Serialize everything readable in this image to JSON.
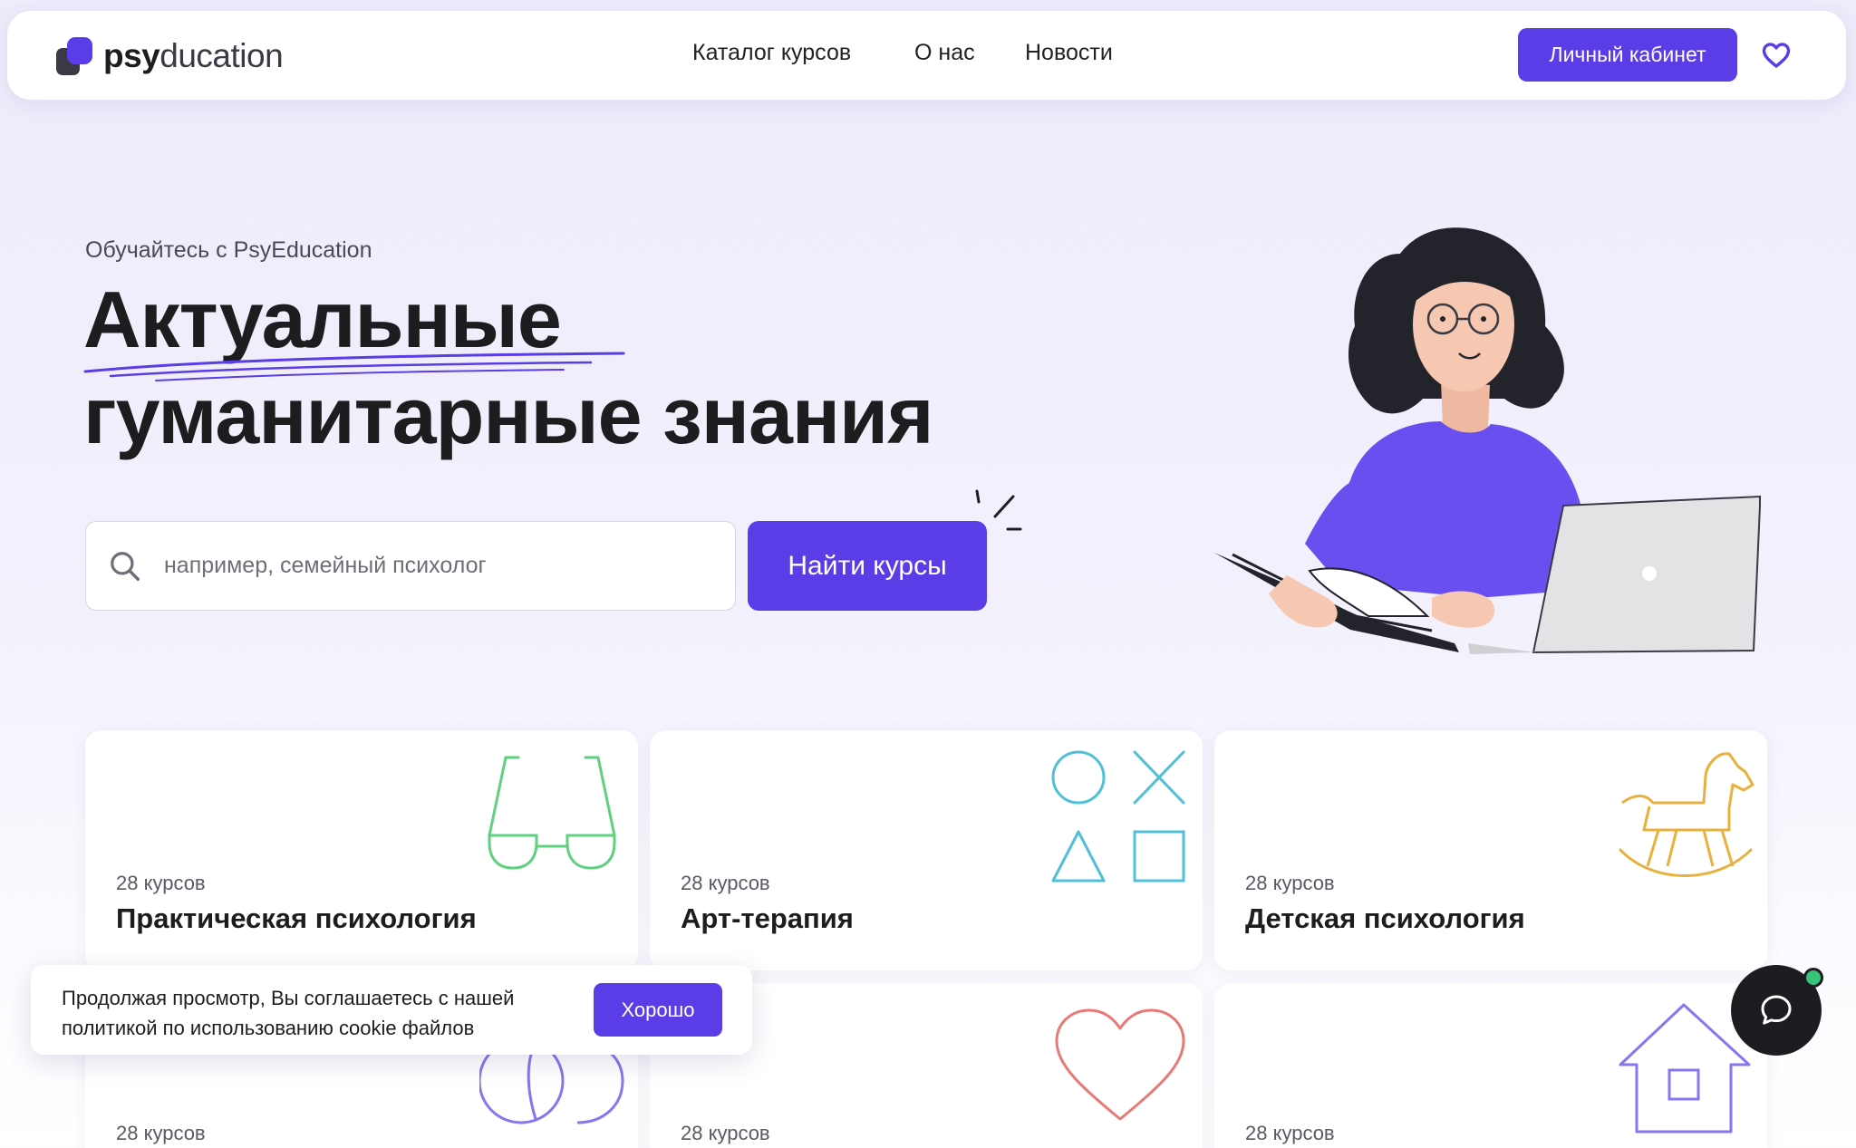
{
  "brand": {
    "part1": "psy",
    "part2": "ducation",
    "accent": "#5b3de8"
  },
  "nav": [
    {
      "label": "Каталог курсов"
    },
    {
      "label": "О нас"
    },
    {
      "label": "Новости"
    }
  ],
  "header": {
    "cabinet_label": "Личный кабинет",
    "favorites_icon": "heart-outline-icon"
  },
  "hero": {
    "subtitle": "Обучайтесь с PsyEducation",
    "title_line1": "Актуальные",
    "title_line2": "гуманитарные знания",
    "search_placeholder": "например, семейный психолог",
    "search_value": "",
    "search_button": "Найти курсы"
  },
  "cards": [
    {
      "count": "28 курсов",
      "title": "Практическая психология",
      "icon": "glasses-icon"
    },
    {
      "count": "28 курсов",
      "title": "Арт-терапия",
      "icon": "shapes-icon"
    },
    {
      "count": "28 курсов",
      "title": "Детская психология",
      "icon": "rocking-horse-icon"
    },
    {
      "count": "28 курсов",
      "title": "",
      "icon": "circles-icon"
    },
    {
      "count": "28 курсов",
      "title": "",
      "icon": "heart-icon"
    },
    {
      "count": "28 курсов",
      "title": "",
      "icon": "house-icon"
    }
  ],
  "cookie": {
    "text": "Продолжая просмотр, Вы соглашаетесь с нашей политикой по использованию cookie файлов",
    "button": "Хорошо"
  },
  "chat": {
    "icon": "chat-bubble-icon",
    "status": "online"
  }
}
